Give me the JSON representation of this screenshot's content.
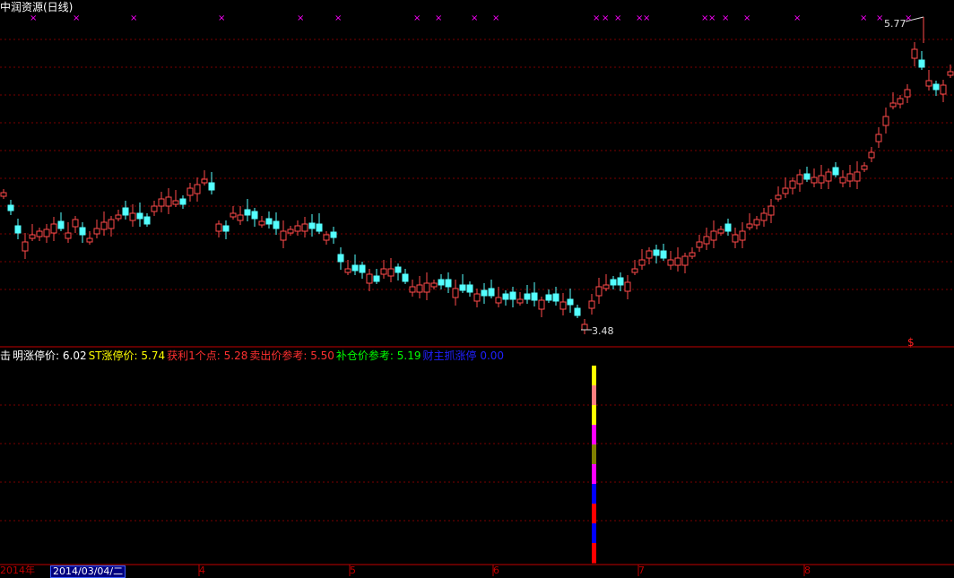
{
  "window": {
    "title": "中润资源(日线)"
  },
  "price_markers": {
    "high": "5.77",
    "low": "3.48",
    "marker_symbol": "$"
  },
  "indicator_line": {
    "items": [
      {
        "label": "击",
        "value": "",
        "color": "#ffffff"
      },
      {
        "label": "明涨停价:",
        "value": "6.02",
        "color": "#ffffff"
      },
      {
        "label": "ST涨停价:",
        "value": "5.74",
        "color": "#ffff00"
      },
      {
        "label": "获利1个点:",
        "value": "5.28",
        "color": "#ff3030"
      },
      {
        "label": "卖出价参考:",
        "value": "5.50",
        "color": "#ff3030"
      },
      {
        "label": "补仓价参考:",
        "value": "5.19",
        "color": "#00ff00"
      },
      {
        "label": "财主抓涨停",
        "value": "0.00",
        "color": "#2020ff"
      }
    ]
  },
  "time_axis": {
    "year_label": "2014年",
    "cursor_date": "2014/03/04/二",
    "month_labels": [
      "4",
      "5",
      "6",
      "7",
      "8"
    ]
  },
  "colors": {
    "up": "#ff4a4a",
    "down": "#54ffff",
    "grid": "#7a0000",
    "marker": "#ff00ff",
    "background": "#000000"
  },
  "chart_data": {
    "type": "candlestick",
    "y_range": [
      3.3,
      6.0
    ],
    "high_value": 5.77,
    "low_value": 3.48,
    "volume_bar_colors": [
      "#ffff00",
      "#ff8080",
      "#ffff00",
      "#ff00ff",
      "#808000",
      "#ff00ff",
      "#0000ff",
      "#ff0000",
      "#0000ff",
      "#ff0000"
    ]
  }
}
